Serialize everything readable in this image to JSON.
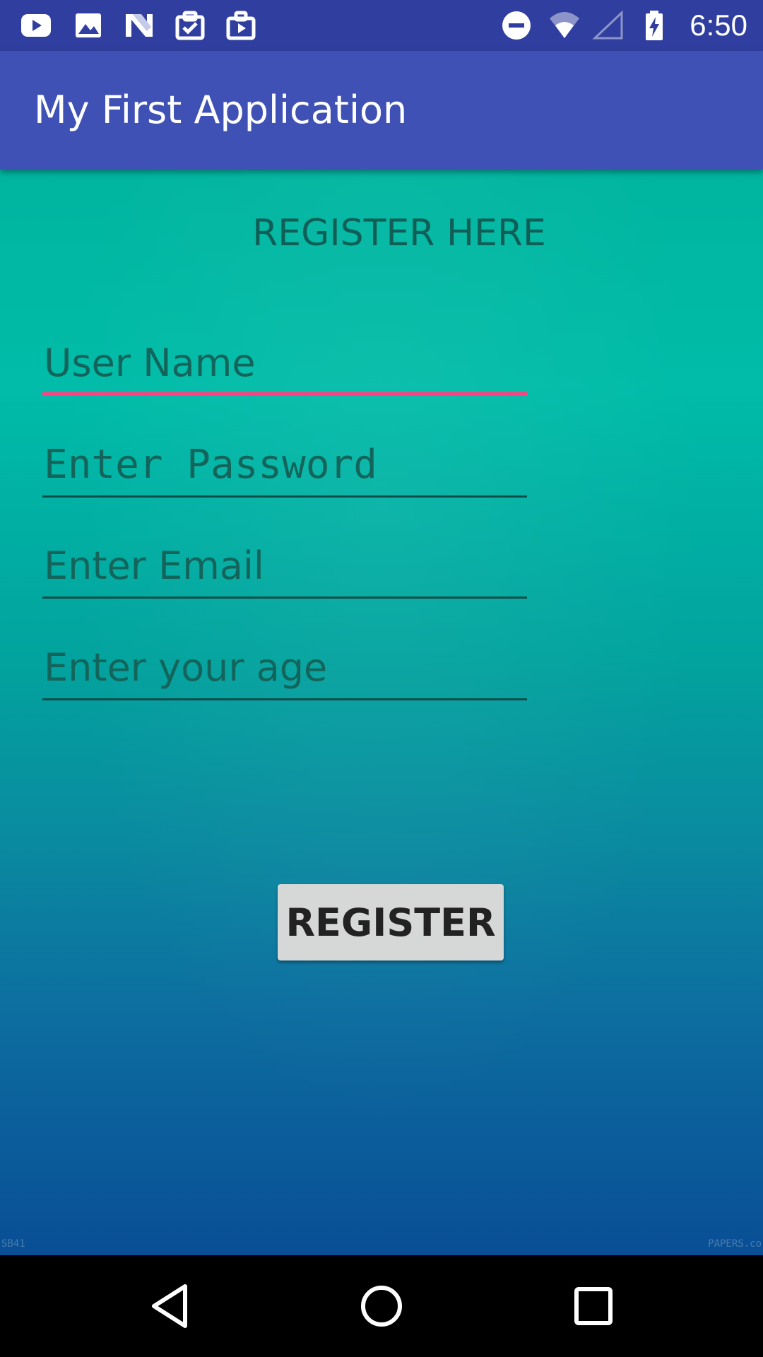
{
  "status_bar": {
    "time": "6:50",
    "left_icons": [
      "youtube-icon",
      "image-icon",
      "n-logo-icon",
      "clipboard-check-icon",
      "briefcase-play-icon"
    ],
    "right_icons": [
      "do-not-disturb-icon",
      "wifi-icon",
      "cell-signal-icon",
      "battery-charging-icon"
    ],
    "background": "#303f9f"
  },
  "app_bar": {
    "title": "My First Application",
    "background": "#3f51b5"
  },
  "form": {
    "heading": "REGISTER HERE",
    "fields": [
      {
        "placeholder": "User Name",
        "value": "",
        "focused": true
      },
      {
        "placeholder": "Enter Password",
        "value": "",
        "focused": false
      },
      {
        "placeholder": "Enter Email",
        "value": "",
        "focused": false
      },
      {
        "placeholder": "Enter your age",
        "value": "",
        "focused": false
      }
    ],
    "register_button": "REGISTER",
    "accent": "#ff4081"
  },
  "watermark": {
    "left": "SB41",
    "right": "PAPERS.co"
  },
  "nav_bar": {
    "buttons": [
      "back-icon",
      "home-icon",
      "recents-icon"
    ]
  }
}
